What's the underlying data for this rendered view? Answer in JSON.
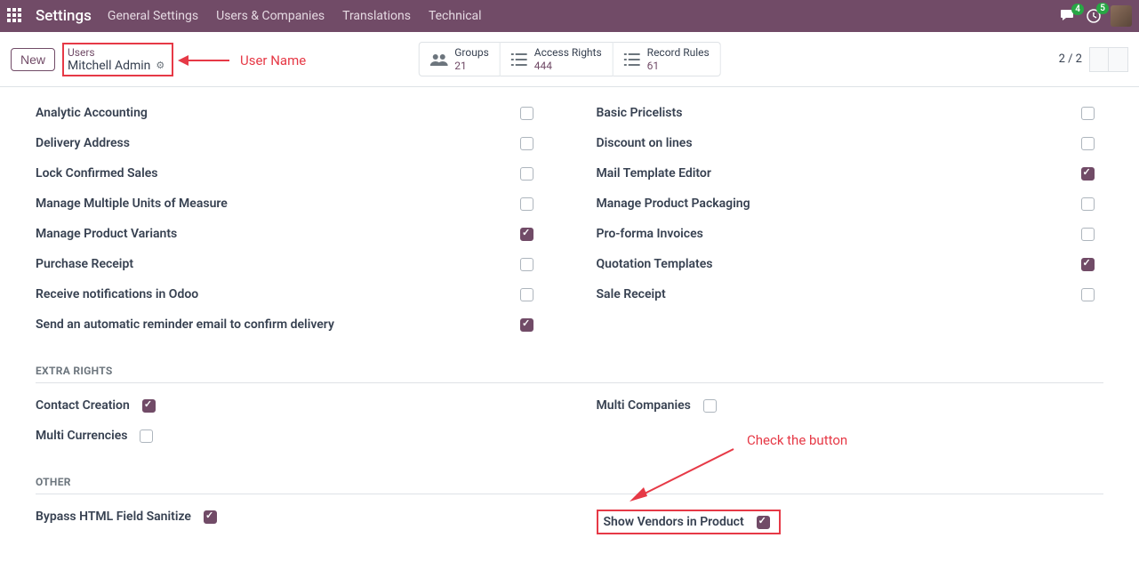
{
  "topbar": {
    "title": "Settings",
    "menu": [
      "General Settings",
      "Users & Companies",
      "Translations",
      "Technical"
    ],
    "msg_badge": "4",
    "clock_badge": "5"
  },
  "subbar": {
    "new_label": "New",
    "breadcrumb": "Users",
    "user_name": "Mitchell Admin",
    "pager": "2 / 2"
  },
  "annotations": {
    "user_name": "User Name",
    "check_button": "Check the button"
  },
  "stats": [
    {
      "label": "Groups",
      "value": "21"
    },
    {
      "label": "Access Rights",
      "value": "444"
    },
    {
      "label": "Record Rules",
      "value": "61"
    }
  ],
  "left_col": [
    {
      "label": "Analytic Accounting",
      "checked": false
    },
    {
      "label": "Delivery Address",
      "checked": false
    },
    {
      "label": "Lock Confirmed Sales",
      "checked": false
    },
    {
      "label": "Manage Multiple Units of Measure",
      "checked": false
    },
    {
      "label": "Manage Product Variants",
      "checked": true
    },
    {
      "label": "Purchase Receipt",
      "checked": false
    },
    {
      "label": "Receive notifications in Odoo",
      "checked": false
    },
    {
      "label": "Send an automatic reminder email to confirm delivery",
      "checked": true
    }
  ],
  "right_col": [
    {
      "label": "Basic Pricelists",
      "checked": false
    },
    {
      "label": "Discount on lines",
      "checked": false
    },
    {
      "label": "Mail Template Editor",
      "checked": true
    },
    {
      "label": "Manage Product Packaging",
      "checked": false
    },
    {
      "label": "Pro-forma Invoices",
      "checked": false
    },
    {
      "label": "Quotation Templates",
      "checked": true
    },
    {
      "label": "Sale Receipt",
      "checked": false
    }
  ],
  "sections": {
    "extra_rights": "EXTRA RIGHTS",
    "other": "OTHER"
  },
  "extra_left": [
    {
      "label": "Contact Creation",
      "checked": true
    },
    {
      "label": "Multi Currencies",
      "checked": false
    }
  ],
  "extra_right": [
    {
      "label": "Multi Companies",
      "checked": false
    }
  ],
  "other_left": [
    {
      "label": "Bypass HTML Field Sanitize",
      "checked": true
    }
  ],
  "other_right": [
    {
      "label": "Show Vendors in Product",
      "checked": true
    }
  ]
}
